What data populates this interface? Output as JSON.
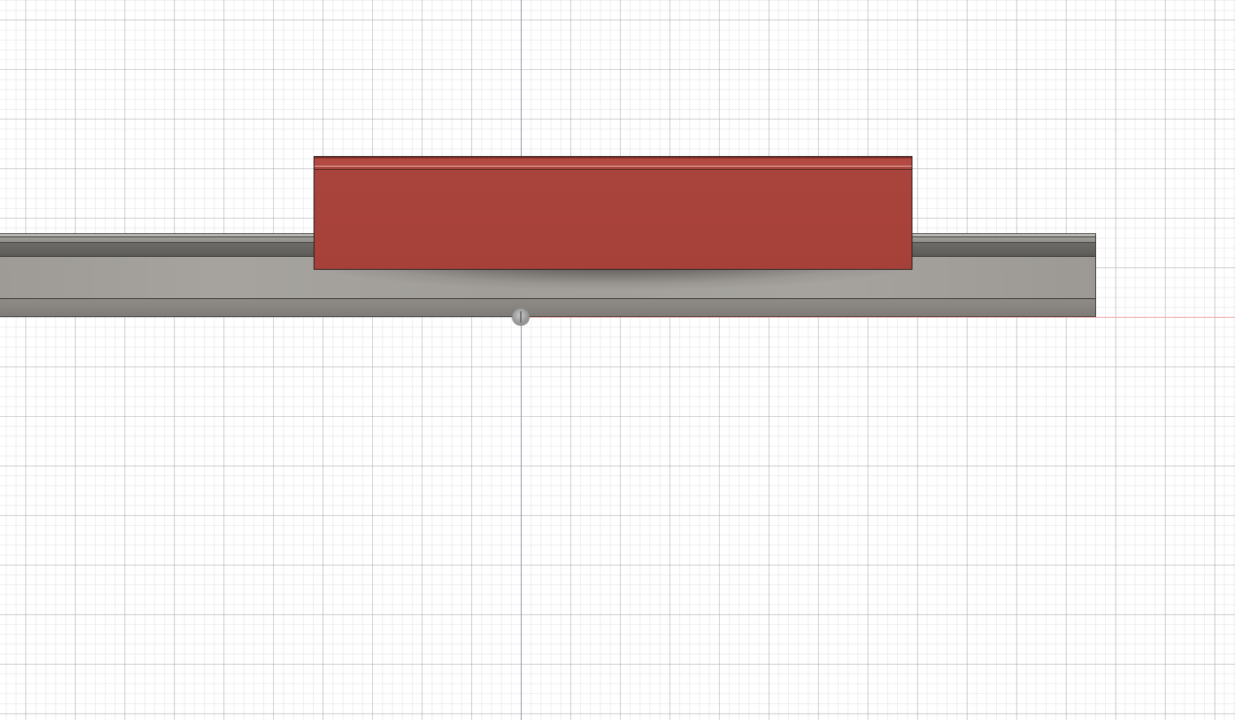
{
  "viewport": {
    "view": "3d-model-viewport",
    "grid": true,
    "colors": {
      "background": "#ffffff",
      "grid_line": "#c8c8d0",
      "axis_vertical": "#8e93a6",
      "axis_horizontal": "#e8a2a2",
      "rail": "#a19e99",
      "block": "#a8433b"
    }
  },
  "scene": {
    "objects": [
      {
        "name": "grey-rail",
        "material_color": "#a19e99"
      },
      {
        "name": "red-block",
        "material_color": "#a8433b"
      }
    ],
    "origin_icon": "origin-point-icon"
  }
}
